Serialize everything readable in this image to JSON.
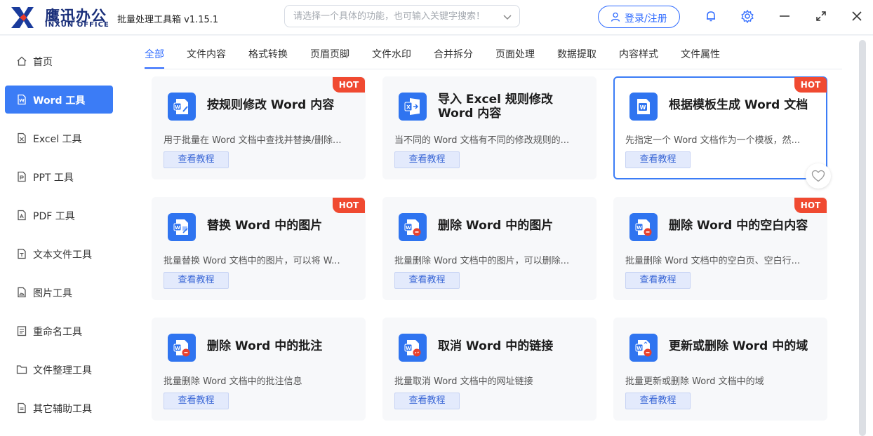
{
  "app": {
    "logo_cn": "鹰迅办公",
    "logo_en": "INXUN OFFICE",
    "title": "批量处理工具箱 v1.15.1",
    "search_placeholder": "请选择一个具体的功能，也可输入关键字搜索！",
    "login_label": "登录/注册"
  },
  "sidebar": {
    "items": [
      {
        "label": "首页",
        "icon": "home-icon"
      },
      {
        "label": "Word 工具",
        "icon": "word-file-icon",
        "active": true
      },
      {
        "label": "Excel 工具",
        "icon": "excel-file-icon"
      },
      {
        "label": "PPT 工具",
        "icon": "ppt-file-icon"
      },
      {
        "label": "PDF 工具",
        "icon": "pdf-file-icon"
      },
      {
        "label": "文本文件工具",
        "icon": "text-file-icon"
      },
      {
        "label": "图片工具",
        "icon": "image-file-icon"
      },
      {
        "label": "重命名工具",
        "icon": "rename-icon"
      },
      {
        "label": "文件整理工具",
        "icon": "folder-icon"
      },
      {
        "label": "其它辅助工具",
        "icon": "tools-icon"
      }
    ]
  },
  "tabs": [
    "全部",
    "文件内容",
    "格式转换",
    "页眉页脚",
    "文件水印",
    "合并拆分",
    "页面处理",
    "数据提取",
    "内容样式",
    "文件属性"
  ],
  "cards": [
    {
      "title": "按规则修改 Word 内容",
      "desc": "用于批量在 Word 文档中查找并替换/删除...",
      "hot": "HOT",
      "button": "查看教程"
    },
    {
      "title": "导入 Excel 规则修改 Word 内容",
      "desc": "当不同的 Word 文档有不同的修改规则的...",
      "button": "查看教程"
    },
    {
      "title": "根据模板生成 Word 文档",
      "desc": "先指定一个 Word 文档作为一个模板，然...",
      "hot": "HOT",
      "button": "查看教程"
    },
    {
      "title": "替换 Word 中的图片",
      "desc": "批量替换 Word 文档中的图片，可以将 W...",
      "hot": "HOT",
      "button": "查看教程"
    },
    {
      "title": "删除 Word 中的图片",
      "desc": "批量删除 Word 文档中的图片，可以删除...",
      "button": "查看教程"
    },
    {
      "title": "删除 Word 中的空白内容",
      "desc": "批量删除 Word 文档中的空白页、空白行...",
      "hot": "HOT",
      "button": "查看教程"
    },
    {
      "title": "删除 Word 中的批注",
      "desc": "批量删除 Word 文档中的批注信息",
      "button": "查看教程"
    },
    {
      "title": "取消 Word 中的链接",
      "desc": "批量取消 Word 文档中的网址链接",
      "button": "查看教程"
    },
    {
      "title": "更新或删除 Word 中的域",
      "desc": "批量更新或删除 Word 文档中的域",
      "button": "查看教程"
    }
  ],
  "colors": {
    "accent": "#2f6bff",
    "active_sidebar": "#3b7cf6",
    "hot_badge": "#f04a31",
    "brand": "#1a2f7a"
  }
}
